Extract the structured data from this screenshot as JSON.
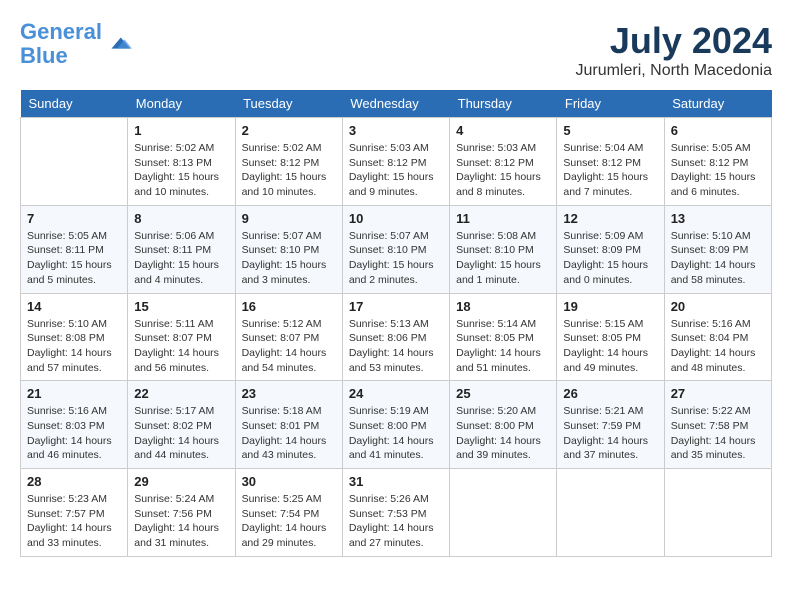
{
  "header": {
    "logo_line1": "General",
    "logo_line2": "Blue",
    "month_year": "July 2024",
    "location": "Jurumleri, North Macedonia"
  },
  "calendar": {
    "days_of_week": [
      "Sunday",
      "Monday",
      "Tuesday",
      "Wednesday",
      "Thursday",
      "Friday",
      "Saturday"
    ],
    "weeks": [
      [
        {
          "day": "",
          "info": ""
        },
        {
          "day": "1",
          "info": "Sunrise: 5:02 AM\nSunset: 8:13 PM\nDaylight: 15 hours\nand 10 minutes."
        },
        {
          "day": "2",
          "info": "Sunrise: 5:02 AM\nSunset: 8:12 PM\nDaylight: 15 hours\nand 10 minutes."
        },
        {
          "day": "3",
          "info": "Sunrise: 5:03 AM\nSunset: 8:12 PM\nDaylight: 15 hours\nand 9 minutes."
        },
        {
          "day": "4",
          "info": "Sunrise: 5:03 AM\nSunset: 8:12 PM\nDaylight: 15 hours\nand 8 minutes."
        },
        {
          "day": "5",
          "info": "Sunrise: 5:04 AM\nSunset: 8:12 PM\nDaylight: 15 hours\nand 7 minutes."
        },
        {
          "day": "6",
          "info": "Sunrise: 5:05 AM\nSunset: 8:12 PM\nDaylight: 15 hours\nand 6 minutes."
        }
      ],
      [
        {
          "day": "7",
          "info": "Sunrise: 5:05 AM\nSunset: 8:11 PM\nDaylight: 15 hours\nand 5 minutes."
        },
        {
          "day": "8",
          "info": "Sunrise: 5:06 AM\nSunset: 8:11 PM\nDaylight: 15 hours\nand 4 minutes."
        },
        {
          "day": "9",
          "info": "Sunrise: 5:07 AM\nSunset: 8:10 PM\nDaylight: 15 hours\nand 3 minutes."
        },
        {
          "day": "10",
          "info": "Sunrise: 5:07 AM\nSunset: 8:10 PM\nDaylight: 15 hours\nand 2 minutes."
        },
        {
          "day": "11",
          "info": "Sunrise: 5:08 AM\nSunset: 8:10 PM\nDaylight: 15 hours\nand 1 minute."
        },
        {
          "day": "12",
          "info": "Sunrise: 5:09 AM\nSunset: 8:09 PM\nDaylight: 15 hours\nand 0 minutes."
        },
        {
          "day": "13",
          "info": "Sunrise: 5:10 AM\nSunset: 8:09 PM\nDaylight: 14 hours\nand 58 minutes."
        }
      ],
      [
        {
          "day": "14",
          "info": "Sunrise: 5:10 AM\nSunset: 8:08 PM\nDaylight: 14 hours\nand 57 minutes."
        },
        {
          "day": "15",
          "info": "Sunrise: 5:11 AM\nSunset: 8:07 PM\nDaylight: 14 hours\nand 56 minutes."
        },
        {
          "day": "16",
          "info": "Sunrise: 5:12 AM\nSunset: 8:07 PM\nDaylight: 14 hours\nand 54 minutes."
        },
        {
          "day": "17",
          "info": "Sunrise: 5:13 AM\nSunset: 8:06 PM\nDaylight: 14 hours\nand 53 minutes."
        },
        {
          "day": "18",
          "info": "Sunrise: 5:14 AM\nSunset: 8:05 PM\nDaylight: 14 hours\nand 51 minutes."
        },
        {
          "day": "19",
          "info": "Sunrise: 5:15 AM\nSunset: 8:05 PM\nDaylight: 14 hours\nand 49 minutes."
        },
        {
          "day": "20",
          "info": "Sunrise: 5:16 AM\nSunset: 8:04 PM\nDaylight: 14 hours\nand 48 minutes."
        }
      ],
      [
        {
          "day": "21",
          "info": "Sunrise: 5:16 AM\nSunset: 8:03 PM\nDaylight: 14 hours\nand 46 minutes."
        },
        {
          "day": "22",
          "info": "Sunrise: 5:17 AM\nSunset: 8:02 PM\nDaylight: 14 hours\nand 44 minutes."
        },
        {
          "day": "23",
          "info": "Sunrise: 5:18 AM\nSunset: 8:01 PM\nDaylight: 14 hours\nand 43 minutes."
        },
        {
          "day": "24",
          "info": "Sunrise: 5:19 AM\nSunset: 8:00 PM\nDaylight: 14 hours\nand 41 minutes."
        },
        {
          "day": "25",
          "info": "Sunrise: 5:20 AM\nSunset: 8:00 PM\nDaylight: 14 hours\nand 39 minutes."
        },
        {
          "day": "26",
          "info": "Sunrise: 5:21 AM\nSunset: 7:59 PM\nDaylight: 14 hours\nand 37 minutes."
        },
        {
          "day": "27",
          "info": "Sunrise: 5:22 AM\nSunset: 7:58 PM\nDaylight: 14 hours\nand 35 minutes."
        }
      ],
      [
        {
          "day": "28",
          "info": "Sunrise: 5:23 AM\nSunset: 7:57 PM\nDaylight: 14 hours\nand 33 minutes."
        },
        {
          "day": "29",
          "info": "Sunrise: 5:24 AM\nSunset: 7:56 PM\nDaylight: 14 hours\nand 31 minutes."
        },
        {
          "day": "30",
          "info": "Sunrise: 5:25 AM\nSunset: 7:54 PM\nDaylight: 14 hours\nand 29 minutes."
        },
        {
          "day": "31",
          "info": "Sunrise: 5:26 AM\nSunset: 7:53 PM\nDaylight: 14 hours\nand 27 minutes."
        },
        {
          "day": "",
          "info": ""
        },
        {
          "day": "",
          "info": ""
        },
        {
          "day": "",
          "info": ""
        }
      ]
    ]
  }
}
